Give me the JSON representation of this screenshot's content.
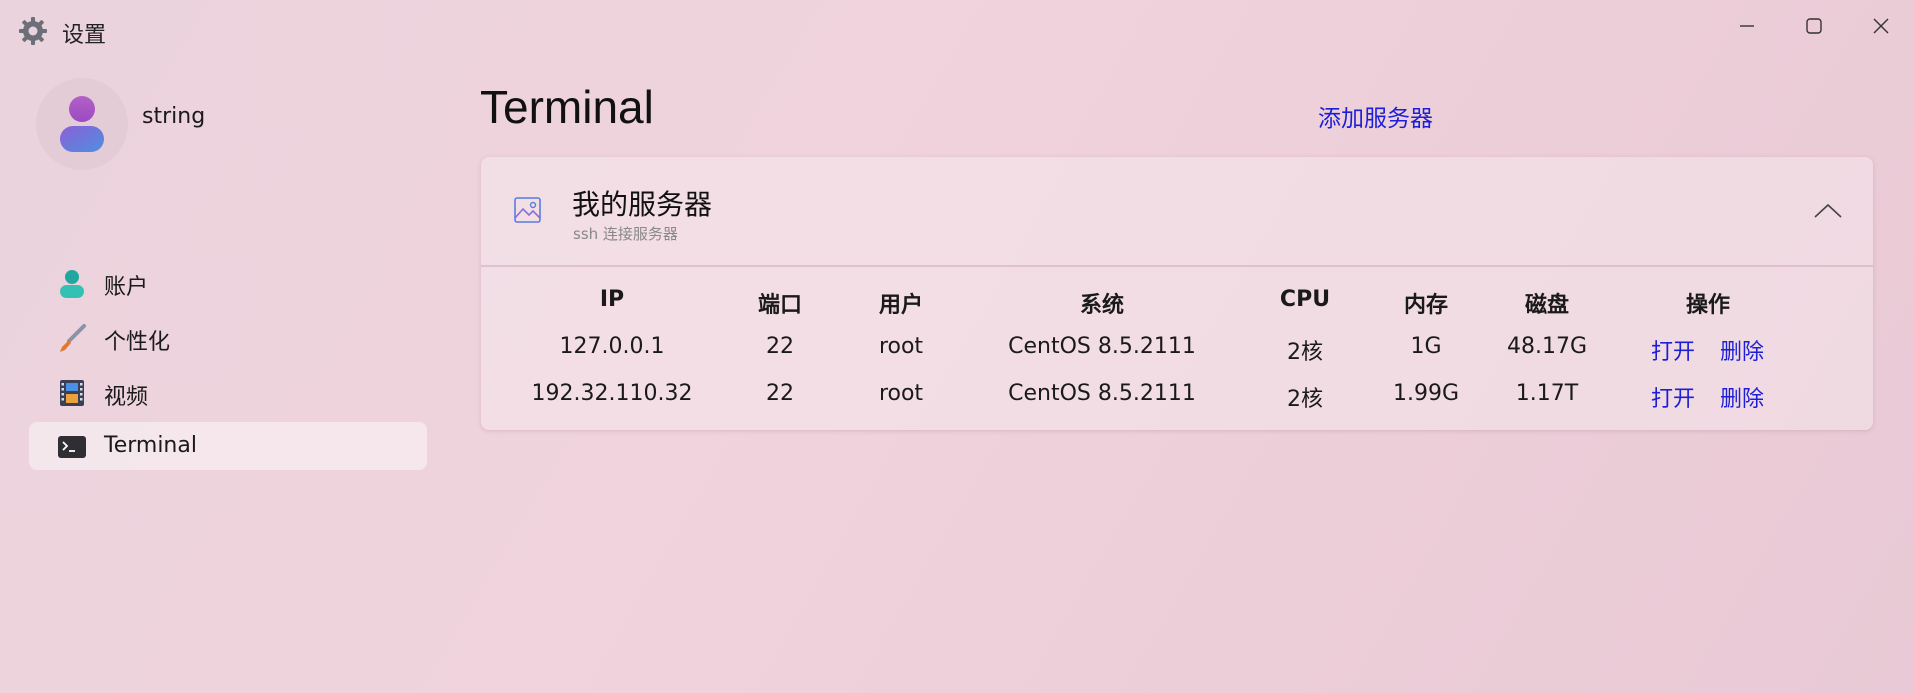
{
  "window": {
    "title": "设置",
    "app_icon": "gear-icon",
    "controls": [
      "minimize-icon",
      "maximize-icon",
      "close-icon"
    ]
  },
  "user": {
    "name": "string",
    "avatar_icon": "person-icon"
  },
  "sidebar": {
    "items": [
      {
        "label": "账户",
        "icon": "account-icon",
        "active": false
      },
      {
        "label": "个性化",
        "icon": "brush-icon",
        "active": false
      },
      {
        "label": "视频",
        "icon": "film-icon",
        "active": false
      },
      {
        "label": "Terminal",
        "icon": "terminal-icon",
        "active": true
      }
    ]
  },
  "main": {
    "title": "Terminal",
    "add_server_label": "添加服务器",
    "card": {
      "title": "我的服务器",
      "subtitle": "ssh 连接服务器",
      "icon": "image-icon",
      "expanded": true,
      "table": {
        "headers": [
          "IP",
          "端口",
          "用户",
          "系统",
          "CPU",
          "内存",
          "磁盘",
          "操作"
        ],
        "rows": [
          {
            "ip": "127.0.0.1",
            "port": "22",
            "user": "root",
            "os": "CentOS 8.5.2111",
            "cpu": "2核",
            "mem": "1G",
            "disk": "48.17G",
            "open": "打开",
            "delete": "删除"
          },
          {
            "ip": "192.32.110.32",
            "port": "22",
            "user": "root",
            "os": "CentOS 8.5.2111",
            "cpu": "2核",
            "mem": "1.99G",
            "disk": "1.17T",
            "open": "打开",
            "delete": "删除"
          }
        ]
      }
    }
  },
  "colors": {
    "link": "#1d1fd6",
    "background": "#eed3dc"
  }
}
